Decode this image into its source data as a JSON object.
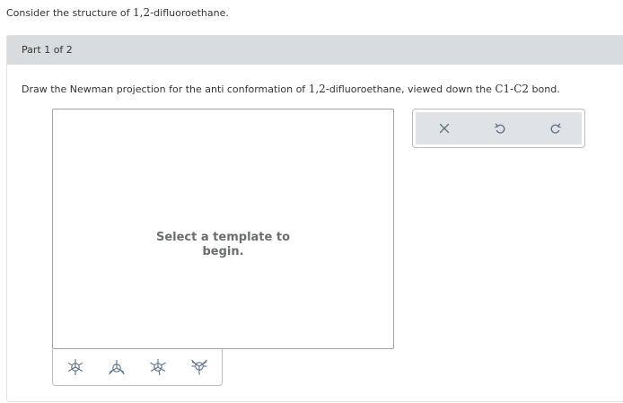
{
  "intro": {
    "prefix": "Consider the structure of ",
    "compound": "1,2-",
    "suffix": "difluoroethane."
  },
  "part": {
    "title": "Part 1 of 2"
  },
  "question": {
    "t1": "Draw the Newman projection for the anti conformation of ",
    "t2": "1,2-",
    "t3": "difluoroethane, viewed down the ",
    "t4": "C1-C2",
    "t5": " bond."
  },
  "canvas": {
    "line1": "Select a template to",
    "line2": "begin."
  },
  "toolbar": {
    "buttons": [
      {
        "icon": "close-icon"
      },
      {
        "icon": "undo-icon"
      },
      {
        "icon": "redo-icon"
      }
    ]
  },
  "templates": [
    {
      "icon": "newman-staggered-icon"
    },
    {
      "icon": "newman-partial-icon"
    },
    {
      "icon": "newman-eclipsed-icon"
    },
    {
      "icon": "newman-alternate-icon"
    }
  ],
  "colors": {
    "header_bg": "#d8dcdf",
    "toolbar_bg": "#dfe3e6",
    "icon": "#5a6f86"
  }
}
